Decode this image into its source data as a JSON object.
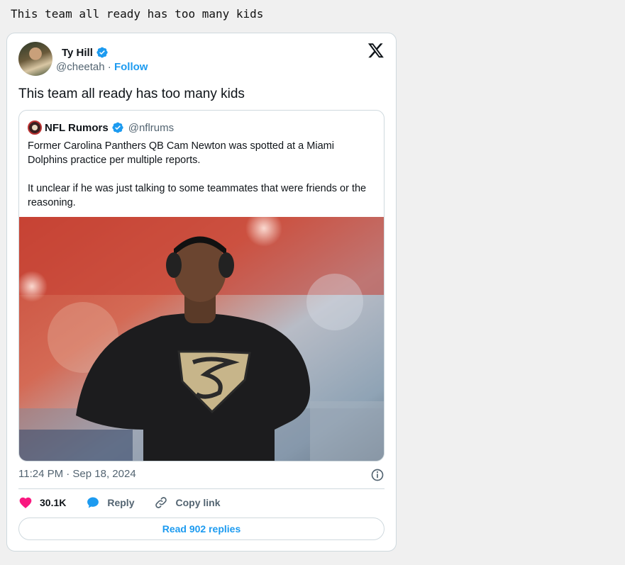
{
  "caption": "This team all ready has too many kids",
  "tweet": {
    "author_name": "Ty Hill",
    "author_handle": "@cheetah",
    "handle_separator": "·",
    "follow_label": "Follow",
    "text": "This team all ready has too many kids",
    "timestamp": "11:24 PM · Sep 18, 2024",
    "like_count": "30.1K",
    "reply_label": "Reply",
    "copy_link_label": "Copy link",
    "read_replies_label": "Read 902 replies"
  },
  "quoted": {
    "name": "NFL Rumors",
    "handle": "@nflrums",
    "paragraph1": "Former Carolina Panthers QB Cam Newton was spotted at a Miami Dolphins practice per multiple reports.",
    "paragraph2": "It unclear if he was just talking to some teammates that were friends or the reasoning."
  },
  "colors": {
    "accent": "#1d9bf0",
    "like": "#f91880",
    "verified": "#1d9bf0"
  },
  "icons": [
    "x-logo-icon",
    "verified-badge-icon",
    "heart-icon",
    "reply-bubble-icon",
    "link-icon",
    "info-icon"
  ]
}
